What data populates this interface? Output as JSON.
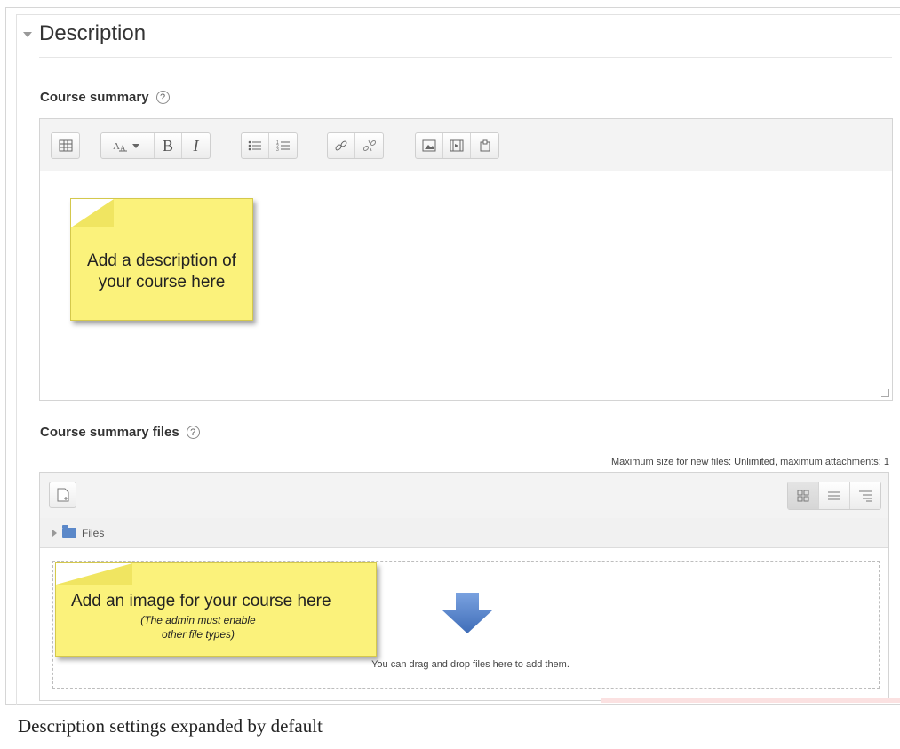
{
  "section": {
    "title": "Description",
    "expanded": true
  },
  "course_summary": {
    "label": "Course summary",
    "help_icon": "help-icon",
    "toolbar": [
      {
        "name": "toolbar-toggle",
        "icon": "kitchen-sink-icon"
      },
      {
        "name": "text-style",
        "icon": "font-style-icon"
      },
      {
        "name": "bold",
        "label": "B"
      },
      {
        "name": "italic",
        "label": "I"
      },
      {
        "name": "unordered-list",
        "icon": "bullet-list-icon"
      },
      {
        "name": "ordered-list",
        "icon": "numbered-list-icon"
      },
      {
        "name": "link",
        "icon": "link-icon"
      },
      {
        "name": "unlink",
        "icon": "unlink-icon"
      },
      {
        "name": "image",
        "icon": "image-icon"
      },
      {
        "name": "media",
        "icon": "media-icon"
      },
      {
        "name": "manage-files",
        "icon": "manage-files-icon"
      }
    ],
    "note_text": "Add a description of your course here"
  },
  "course_summary_files": {
    "label": "Course summary files",
    "help_icon": "help-icon",
    "limits_text": "Maximum size for new files: Unlimited, maximum attachments: 1",
    "path_label": "Files",
    "drop_text": "You can drag and drop files here to add them.",
    "note_title": "Add an image for your course here",
    "note_sub_line1": "(The admin must enable",
    "note_sub_line2": "other file types)"
  },
  "caption": "Description settings expanded by default",
  "colors": {
    "note_yellow": "#fbf27b",
    "arrow_blue": "#4a78c2"
  }
}
